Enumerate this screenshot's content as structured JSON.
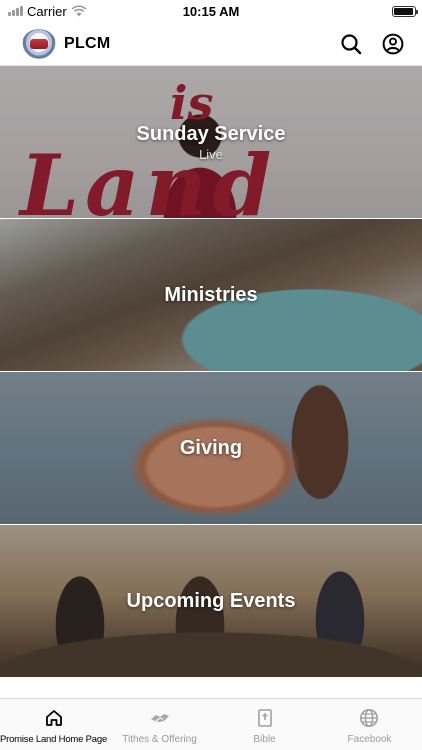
{
  "status_bar": {
    "carrier": "Carrier",
    "time": "10:15 AM",
    "battery_level": 0.95
  },
  "header": {
    "title": "PLCM"
  },
  "tiles": [
    {
      "title": "Sunday Service",
      "subtitle": "Live"
    },
    {
      "title": "Ministries"
    },
    {
      "title": "Giving"
    },
    {
      "title": "Upcoming Events"
    }
  ],
  "sunday_backdrop_words": {
    "is": "is",
    "land": "Land"
  },
  "tabs": [
    {
      "label": "Promise Land Home Page",
      "icon": "home-icon",
      "active": true
    },
    {
      "label": "Tithes & Offering",
      "icon": "handshake-icon",
      "active": false
    },
    {
      "label": "Bible",
      "icon": "bible-icon",
      "active": false
    },
    {
      "label": "Facebook",
      "icon": "globe-icon",
      "active": false
    }
  ],
  "colors": {
    "accent_text": "#000000",
    "inactive_tab": "#9a9a9a",
    "brand_red": "#b5263a"
  }
}
